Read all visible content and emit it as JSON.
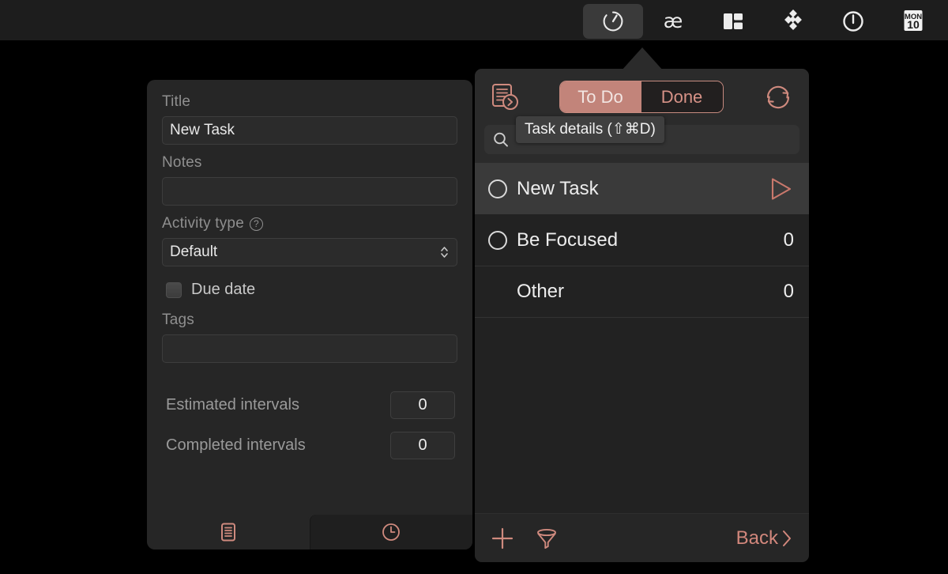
{
  "menubar": {
    "items": [
      {
        "name": "timer-menu-icon",
        "label": "Timer",
        "active": true
      },
      {
        "name": "ae-menu-icon",
        "label": "æ",
        "active": false
      },
      {
        "name": "layout-menu-icon",
        "label": "Layout",
        "active": false
      },
      {
        "name": "dropbox-menu-icon",
        "label": "Dropbox",
        "active": false
      },
      {
        "name": "power-menu-icon",
        "label": "Power",
        "active": false
      },
      {
        "name": "calendar-menu-icon",
        "label": "Calendar",
        "active": false
      }
    ],
    "calendar": {
      "weekday": "MON",
      "day": "10"
    }
  },
  "details": {
    "title_label": "Title",
    "title_value": "New Task",
    "notes_label": "Notes",
    "notes_value": "",
    "activity_type_label": "Activity type",
    "activity_type_help": "?",
    "activity_type_value": "Default",
    "due_date_label": "Due date",
    "due_date_checked": false,
    "tags_label": "Tags",
    "tags_value": "",
    "estimated_label": "Estimated intervals",
    "estimated_value": "0",
    "completed_label": "Completed intervals",
    "completed_value": "0",
    "tabs": [
      {
        "name": "task-details-tab",
        "icon": "document-lines-icon",
        "active": true
      },
      {
        "name": "task-history-tab",
        "icon": "clock-icon",
        "active": false
      }
    ]
  },
  "popover": {
    "details_button_icon": "document-arrow-icon",
    "sync_button_icon": "sync-icon",
    "segments": [
      {
        "label": "To Do",
        "selected": true
      },
      {
        "label": "Done",
        "selected": false
      }
    ],
    "search": {
      "icon": "search-icon",
      "value": "",
      "placeholder": ""
    },
    "tooltip": "Task details (⇧⌘D)",
    "tasks": [
      {
        "title": "New Task",
        "count": "",
        "selected": true,
        "has_radio": true,
        "action": "play-icon"
      },
      {
        "title": "Be Focused",
        "count": "0",
        "selected": false,
        "has_radio": true,
        "action": ""
      },
      {
        "title": "Other",
        "count": "0",
        "selected": false,
        "has_radio": false,
        "action": ""
      }
    ],
    "footer": {
      "add_icon": "plus-icon",
      "filter_icon": "funnel-icon",
      "back_label": "Back"
    }
  },
  "colors": {
    "accent": "#d2877c",
    "accent_fill": "#c2847a",
    "menubar_bg": "#1d1d1d",
    "panel_bg": "#262626",
    "popover_bg": "#222222",
    "desktop_bg": "#000000"
  }
}
